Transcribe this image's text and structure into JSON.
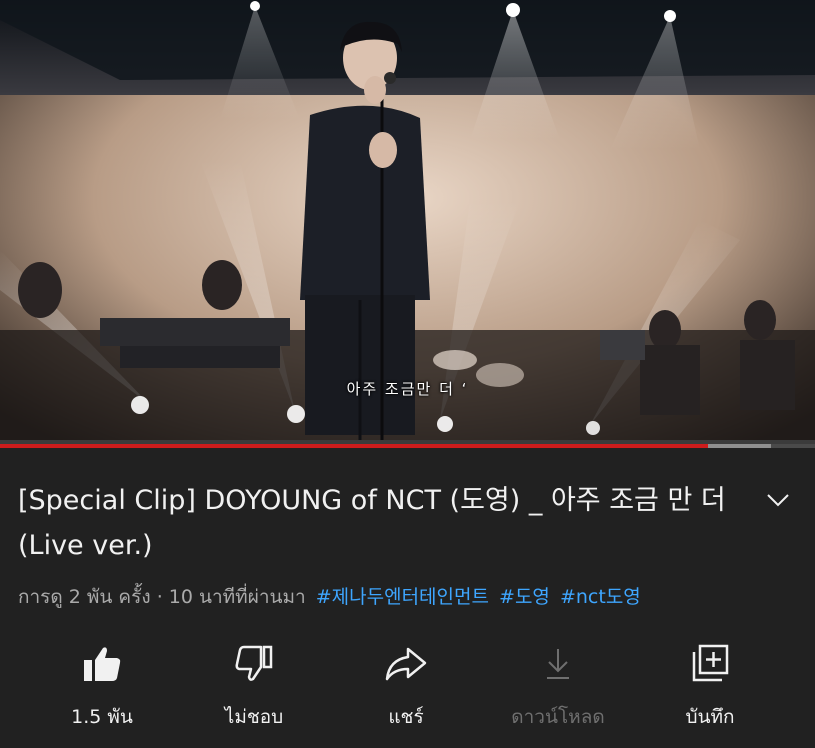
{
  "video": {
    "subtitle": "아주 조금만 더 ‘"
  },
  "player": {
    "progress_fraction": 0.869,
    "buffer_fraction": 0.946,
    "played_color": "#cc1c1c"
  },
  "title": "[Special Clip] DOYOUNG of NCT (도영) _ 아주 조금 만 더 (Live ver.)",
  "meta": {
    "views": "การดู 2 พัน ครั้ง",
    "separator": "·",
    "time": "10 นาทีที่ผ่านมา",
    "hashtags": [
      "#제나두엔터테인먼트",
      "#도영",
      "#nct도영"
    ]
  },
  "actions": {
    "like": {
      "label": "1.5 พัน",
      "icon": "thumbs-up-icon"
    },
    "dislike": {
      "label": "ไม่ชอบ",
      "icon": "thumbs-down-icon"
    },
    "share": {
      "label": "แชร์",
      "icon": "share-icon"
    },
    "download": {
      "label": "ดาวน์โหลด",
      "icon": "download-icon"
    },
    "save": {
      "label": "บันทึก",
      "icon": "add-to-playlist-icon"
    }
  },
  "colors": {
    "background": "#212121",
    "text": "#f1f1f1",
    "secondary_text": "#aaaaaa",
    "hashtag": "#3ea6ff"
  }
}
